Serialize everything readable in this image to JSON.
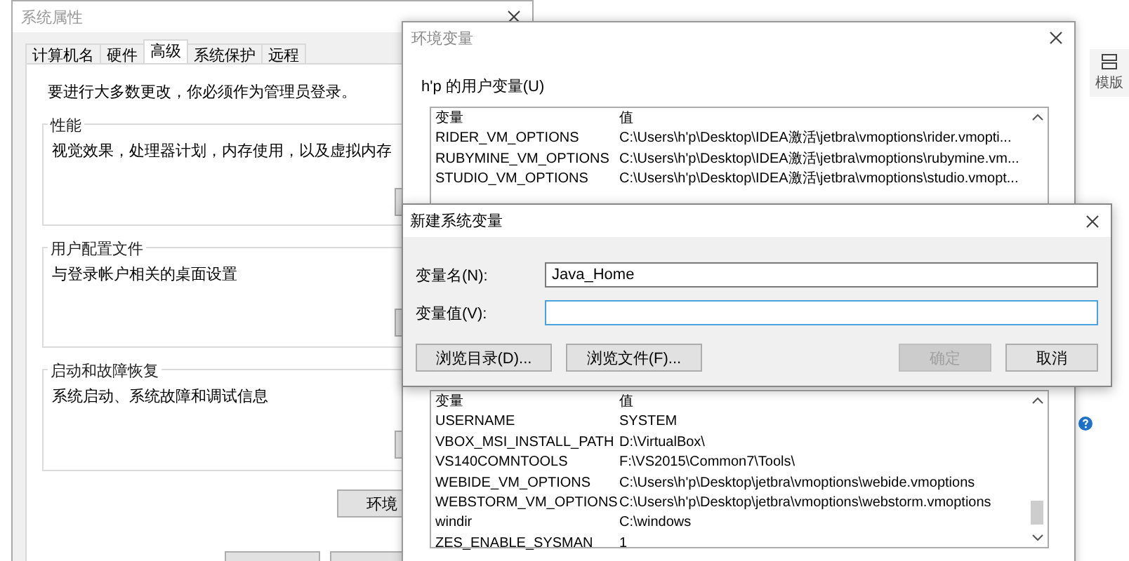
{
  "background": {
    "template_label": "模版"
  },
  "system_properties": {
    "title": "系统属性",
    "tabs": [
      {
        "label": "计算机名",
        "selected": false
      },
      {
        "label": "硬件",
        "selected": false
      },
      {
        "label": "高级",
        "selected": true
      },
      {
        "label": "系统保护",
        "selected": false
      },
      {
        "label": "远程",
        "selected": false
      }
    ],
    "notice": "要进行大多数更改，你必须作为管理员登录。",
    "groups": [
      {
        "title": "性能",
        "description": "视觉效果，处理器计划，内存使用，以及虚拟内存"
      },
      {
        "title": "用户配置文件",
        "description": "与登录帐户相关的桌面设置"
      },
      {
        "title": "启动和故障恢复",
        "description": "系统启动、系统故障和调试信息"
      }
    ],
    "environment_button": "环境"
  },
  "environment_variables": {
    "title": "环境变量",
    "user_group": "h'p 的用户变量(U)",
    "user_variables": {
      "columns": [
        "变量",
        "值"
      ],
      "rows": [
        [
          "RIDER_VM_OPTIONS",
          "C:\\Users\\h'p\\Desktop\\IDEA激活\\jetbra\\vmoptions\\rider.vmopti..."
        ],
        [
          "RUBYMINE_VM_OPTIONS",
          "C:\\Users\\h'p\\Desktop\\IDEA激活\\jetbra\\vmoptions\\rubymine.vm..."
        ],
        [
          "STUDIO_VM_OPTIONS",
          "C:\\Users\\h'p\\Desktop\\IDEA激活\\jetbra\\vmoptions\\studio.vmopt..."
        ]
      ]
    },
    "system_variables": {
      "columns": [
        "变量",
        "值"
      ],
      "rows": [
        [
          "USERNAME",
          "SYSTEM"
        ],
        [
          "VBOX_MSI_INSTALL_PATH",
          "D:\\VirtualBox\\"
        ],
        [
          "VS140COMNTOOLS",
          "F:\\VS2015\\Common7\\Tools\\"
        ],
        [
          "WEBIDE_VM_OPTIONS",
          "C:\\Users\\h'p\\Desktop\\jetbra\\vmoptions\\webide.vmoptions"
        ],
        [
          "WEBSTORM_VM_OPTIONS",
          "C:\\Users\\h'p\\Desktop\\jetbra\\vmoptions\\webstorm.vmoptions"
        ],
        [
          "windir",
          "C:\\windows"
        ],
        [
          "ZES_ENABLE_SYSMAN",
          "1"
        ]
      ]
    }
  },
  "new_variable_dialog": {
    "title": "新建系统变量",
    "fields": [
      {
        "label": "变量名(N):",
        "value": "Java_Home",
        "focused": false
      },
      {
        "label": "变量值(V):",
        "focused": true
      }
    ],
    "left_buttons": [
      {
        "label": "浏览目录(D)...",
        "disabled": false
      },
      {
        "label": "浏览文件(F)...",
        "disabled": false
      }
    ],
    "right_buttons": [
      {
        "label": "确定",
        "disabled": true
      },
      {
        "label": "取消",
        "disabled": false
      }
    ]
  }
}
